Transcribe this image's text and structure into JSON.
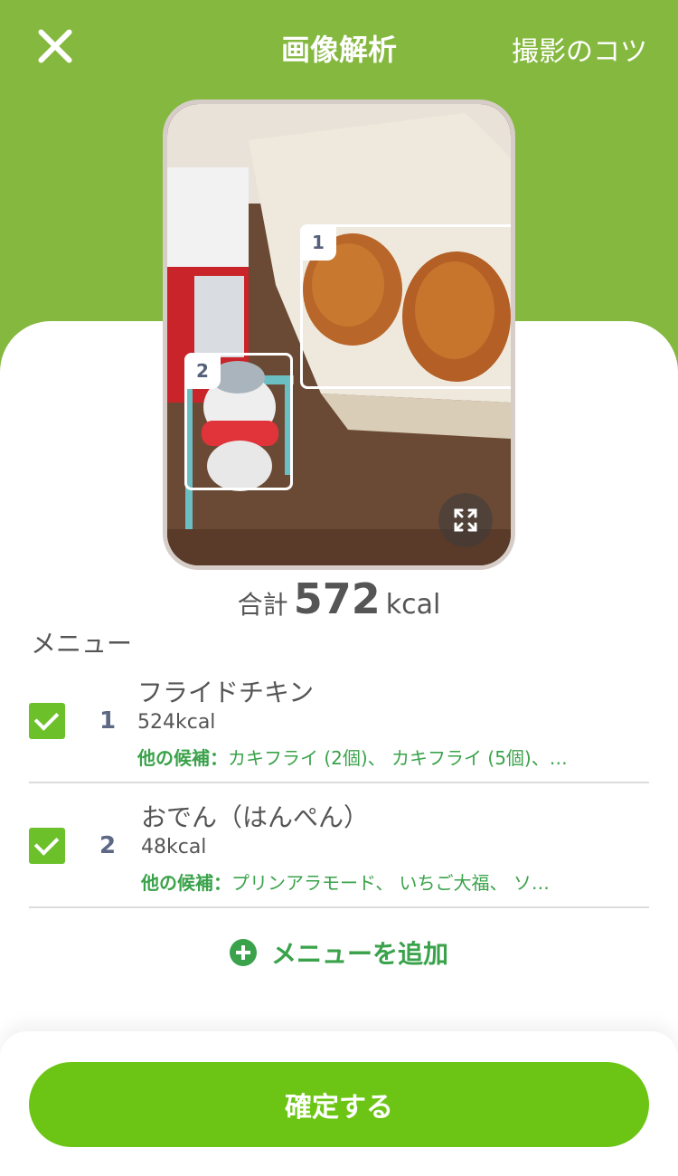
{
  "header": {
    "title": "画像解析",
    "tips_label": "撮影のコツ"
  },
  "photo": {
    "detections": [
      {
        "tag": "1"
      },
      {
        "tag": "2"
      }
    ]
  },
  "total": {
    "label": "合計",
    "value": "572",
    "unit": "kcal"
  },
  "menu": {
    "section_title": "メニュー",
    "items": [
      {
        "number": "1",
        "name": "フライドチキン",
        "kcal": "524kcal",
        "alt_label": "他の候補：",
        "alt_values": "カキフライ (2個)、 カキフライ (5個)、…",
        "checked": true
      },
      {
        "number": "2",
        "name": "おでん（はんぺん）",
        "kcal": "48kcal",
        "alt_label": "他の候補：",
        "alt_values": "プリンアラモード、 いちご大福、 ソ…",
        "checked": true
      }
    ],
    "add_label": "メニューを追加"
  },
  "footer": {
    "confirm_label": "確定する"
  },
  "colors": {
    "header_bg": "#85b83f",
    "accent_green": "#6cc515",
    "text_green": "#3aa24a"
  },
  "icons": [
    "close-icon",
    "expand-icon",
    "check-icon",
    "plus-circle-icon"
  ]
}
